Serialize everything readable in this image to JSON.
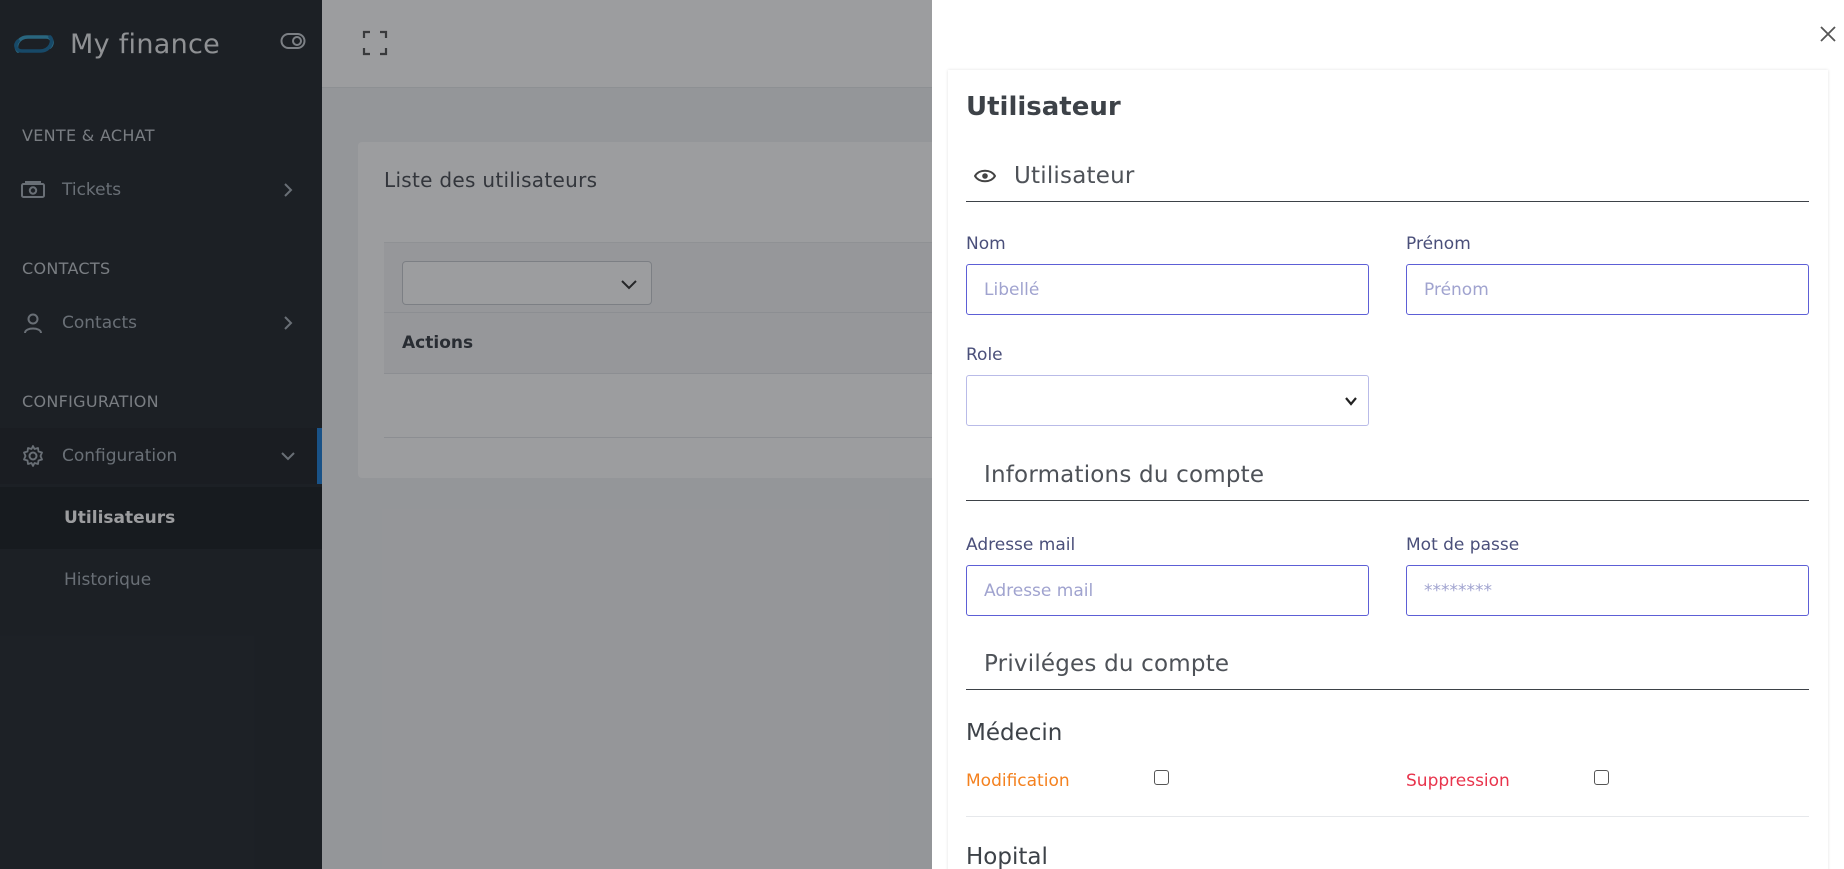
{
  "app": {
    "name": "My finance"
  },
  "sidebar": {
    "sections": [
      {
        "title": "VENTE & ACHAT"
      },
      {
        "title": "CONTACTS"
      },
      {
        "title": "CONFIGURATION"
      }
    ],
    "items": {
      "tickets": "Tickets",
      "contacts": "Contacts",
      "configuration": "Configuration"
    },
    "sub_items": {
      "utilisateurs": "Utilisateurs",
      "historique": "Historique"
    }
  },
  "main": {
    "card_title": "Liste des utilisateurs",
    "table": {
      "headers": [
        "Actions"
      ]
    }
  },
  "drawer": {
    "title": "Utilisateur",
    "sections": {
      "user": "Utilisateur",
      "account_info": "Informations du compte",
      "privileges": "Priviléges du compte"
    },
    "fields": {
      "nom": {
        "label": "Nom",
        "placeholder": "Libellé"
      },
      "prenom": {
        "label": "Prénom",
        "placeholder": "Prénom"
      },
      "role": {
        "label": "Role",
        "value": ""
      },
      "email": {
        "label": "Adresse mail",
        "placeholder": "Adresse mail"
      },
      "password": {
        "label": "Mot de passe",
        "placeholder": "********"
      }
    },
    "privilege_groups": [
      {
        "name": "Médecin",
        "modification": "Modification",
        "suppression": "Suppression"
      },
      {
        "name": "Hopital"
      }
    ]
  },
  "colors": {
    "sidebar_bg": "#24292e",
    "accent": "#1e7fd6",
    "input_border": "#5d5fd6",
    "modification": "#f4811f",
    "suppression": "#e8344c"
  }
}
